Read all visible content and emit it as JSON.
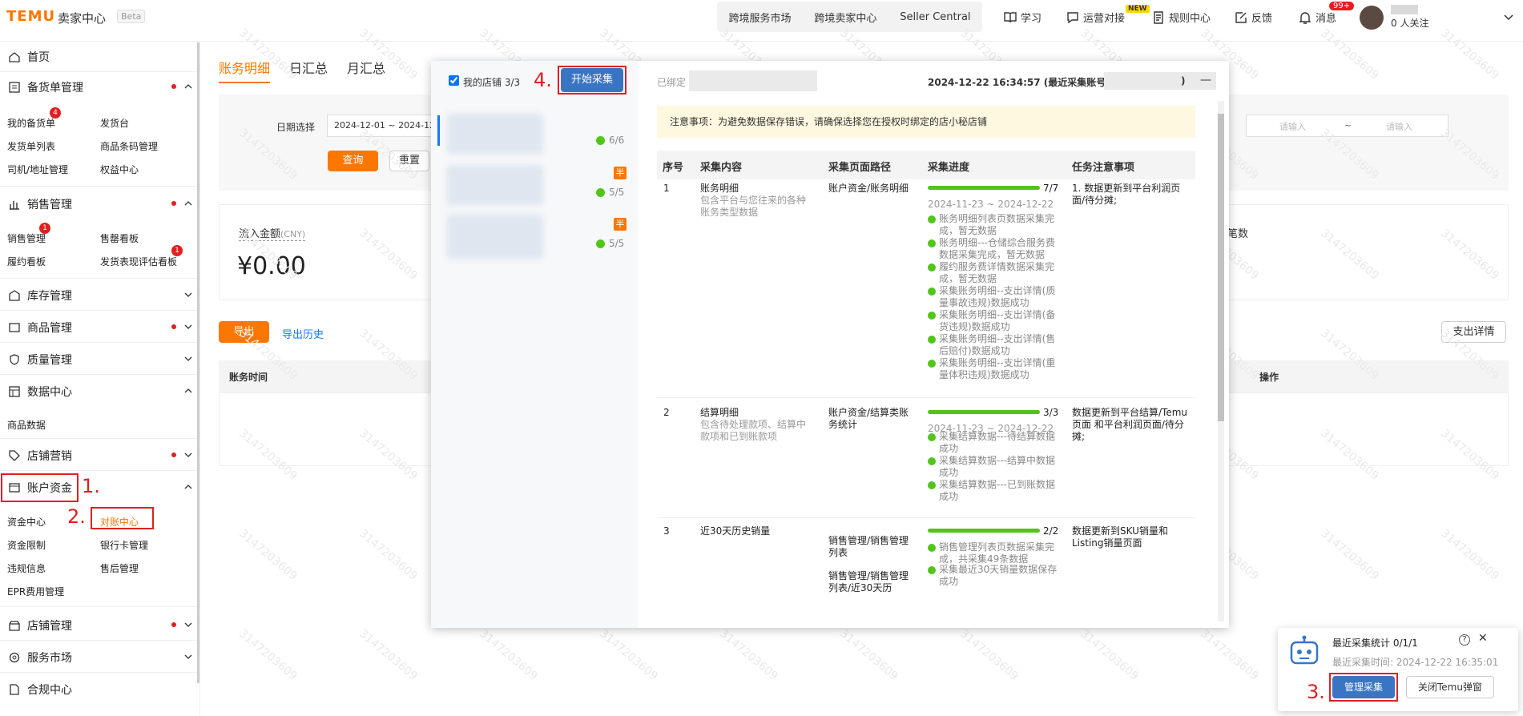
{
  "brand": {
    "logo": "TEMU",
    "seller_center": "卖家中心",
    "beta": "Beta"
  },
  "topnav": {
    "links": [
      "跨境服务市场",
      "跨境卖家中心",
      "Seller Central"
    ],
    "study": "学习",
    "ops": "运营对接",
    "new": "NEW",
    "rules": "规则中心",
    "feedback": "反馈",
    "messages": "消息",
    "msg_badge": "99+",
    "followers": "0 人关注"
  },
  "sidebar": {
    "home": "首页",
    "stock": "备货单管理",
    "stock_sub": [
      "我的备货单",
      "发货台",
      "发货单列表",
      "商品条码管理",
      "司机/地址管理",
      "权益中心"
    ],
    "sales": "销售管理",
    "sales_sub": [
      "销售管理",
      "售罄看板",
      "履约看板",
      "发货表现评估看板"
    ],
    "inventory": "库存管理",
    "goods": "商品管理",
    "quality": "质量管理",
    "data": "数据中心",
    "data_sub": [
      "商品数据"
    ],
    "marketing": "店铺营销",
    "account": "账户资金",
    "account_sub": [
      "资金中心",
      "对账中心",
      "资金限制",
      "银行卡管理",
      "违规信息",
      "售后管理",
      "EPR费用管理"
    ],
    "shop": "店铺管理",
    "service": "服务市场",
    "compliance": "合规中心",
    "badge": "4",
    "badge1": "1",
    "badge2": "1"
  },
  "annotations": {
    "a1": "1.",
    "a2": "2.",
    "a3": "3.",
    "a4": "4."
  },
  "main": {
    "tabs": [
      "账务明细",
      "日汇总",
      "月汇总"
    ],
    "date_label": "日期选择",
    "date_value": "2024-12-01 ~ 2024-12",
    "query": "查询",
    "reset": "重置",
    "ph_input": "请输入",
    "tilde": "~",
    "inflow_label": "流入金额",
    "inflow_unit": "(CNY)",
    "inflow_value": "¥0.00",
    "count_label": "笔数",
    "export": "导出",
    "export_history": "导出历史",
    "expense_detail": "支出详情",
    "col_time": "账务时间",
    "col_op": "操作"
  },
  "modal": {
    "my_shops": "我的店铺",
    "shops_count": "3/3",
    "start": "开始采集",
    "bound": "已绑定",
    "time": "2024-12-22 16:34:57 (最近采集账号:",
    "close_paren": ")",
    "shops": [
      {
        "ok": "6/6"
      },
      {
        "ok": "5/5",
        "tag": "半"
      },
      {
        "ok": "5/5",
        "tag": "半"
      }
    ],
    "notice": "注意事项：为避免数据保存错误，请确保选择您在授权时绑定的店小秘店铺",
    "headers": [
      "序号",
      "采集内容",
      "采集页面路径",
      "采集进度",
      "任务注意事项"
    ],
    "rows": [
      {
        "no": "1",
        "title": "账务明细",
        "desc": "包含平台与您往来的各种账务类型数据",
        "path": "账户资金/账务明细",
        "progress": 1.0,
        "count": "7/7",
        "range": "2024-11-23 ~ 2024-12-22",
        "steps": [
          "账务明细列表页数据采集完成，暂无数据",
          "账务明细---仓储综合服务费数据采集完成，暂无数据",
          "履约服务费详情数据采集完成，暂无数据",
          "采集账务明细--支出详情(质量事故违规)数据成功",
          "采集账务明细--支出详情(备货违规)数据成功",
          "采集账务明细--支出详情(售后赔付)数据成功",
          "采集账务明细--支出详情(重量体积违规)数据成功"
        ],
        "note": "1. 数据更新到平台利润页面/待分摊;"
      },
      {
        "no": "2",
        "title": "结算明细",
        "desc": "包含待处理款项、结算中款项和已到账款项",
        "path": "账户资金/结算类账务统计",
        "progress": 1.0,
        "count": "3/3",
        "range": "2024-11-23 ~ 2024-12-22",
        "steps": [
          "采集结算数据---待结算数据成功",
          "采集结算数据---结算中数据成功",
          "采集结算数据---已到账数据成功"
        ],
        "note": "数据更新到平台结算/Temu页面 和平台利润页面/待分摊;"
      },
      {
        "no": "3",
        "title": "近30天历史销量",
        "path": "销售管理/销售管理列表",
        "path2": "销售管理/销售管理列表/近30天历",
        "progress": 1.0,
        "count": "2/2",
        "steps": [
          "销售管理列表页数据采集完成，共采集49条数据",
          "采集最近30天销量数据保存成功"
        ],
        "note": "数据更新到SKU销量和Listing销量页面"
      }
    ]
  },
  "collect": {
    "title": "最近采集统计 0/1/1",
    "time_label": "最近采集时间:",
    "time": "2024-12-22 16:35:01",
    "manage": "管理采集",
    "close": "关闭Temu弹窗"
  },
  "watermark": "3147203609"
}
